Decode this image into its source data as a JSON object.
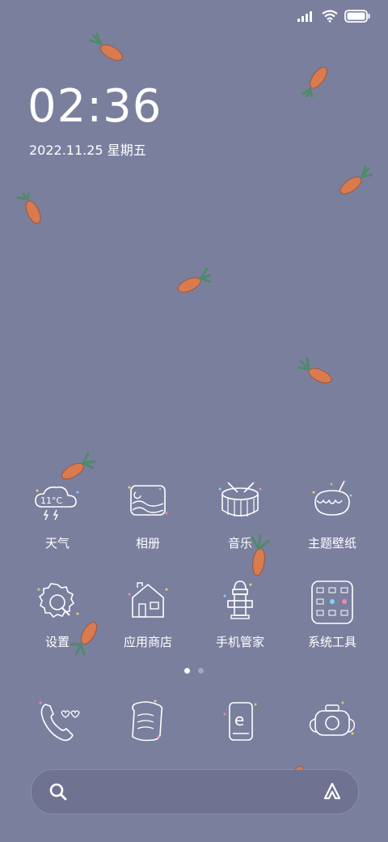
{
  "status_bar": {
    "icons": [
      "signal-icon",
      "wifi-icon",
      "battery-icon"
    ]
  },
  "clock": {
    "time": "02:36",
    "date": "2022.11.25 星期五"
  },
  "apps": [
    {
      "label": "天气",
      "icon": "weather-icon",
      "icon_text": "11°C"
    },
    {
      "label": "相册",
      "icon": "gallery-icon"
    },
    {
      "label": "音乐",
      "icon": "music-drum-icon"
    },
    {
      "label": "主题壁纸",
      "icon": "themes-icon"
    },
    {
      "label": "设置",
      "icon": "settings-icon"
    },
    {
      "label": "应用商店",
      "icon": "app-store-icon"
    },
    {
      "label": "手机管家",
      "icon": "security-icon"
    },
    {
      "label": "系统工具",
      "icon": "tools-icon"
    }
  ],
  "dock": [
    {
      "icon": "phone-icon"
    },
    {
      "icon": "messages-icon"
    },
    {
      "icon": "browser-icon",
      "icon_text": "e"
    },
    {
      "icon": "camera-icon"
    }
  ],
  "page_indicator": {
    "count": 2,
    "active": 1
  },
  "colors": {
    "background": "#7b7f9e",
    "carrot": "#d97b4f",
    "leaf": "#4f8a6a",
    "dot_active": "#ffffff",
    "dot_inactive": "#a3a6c0"
  }
}
